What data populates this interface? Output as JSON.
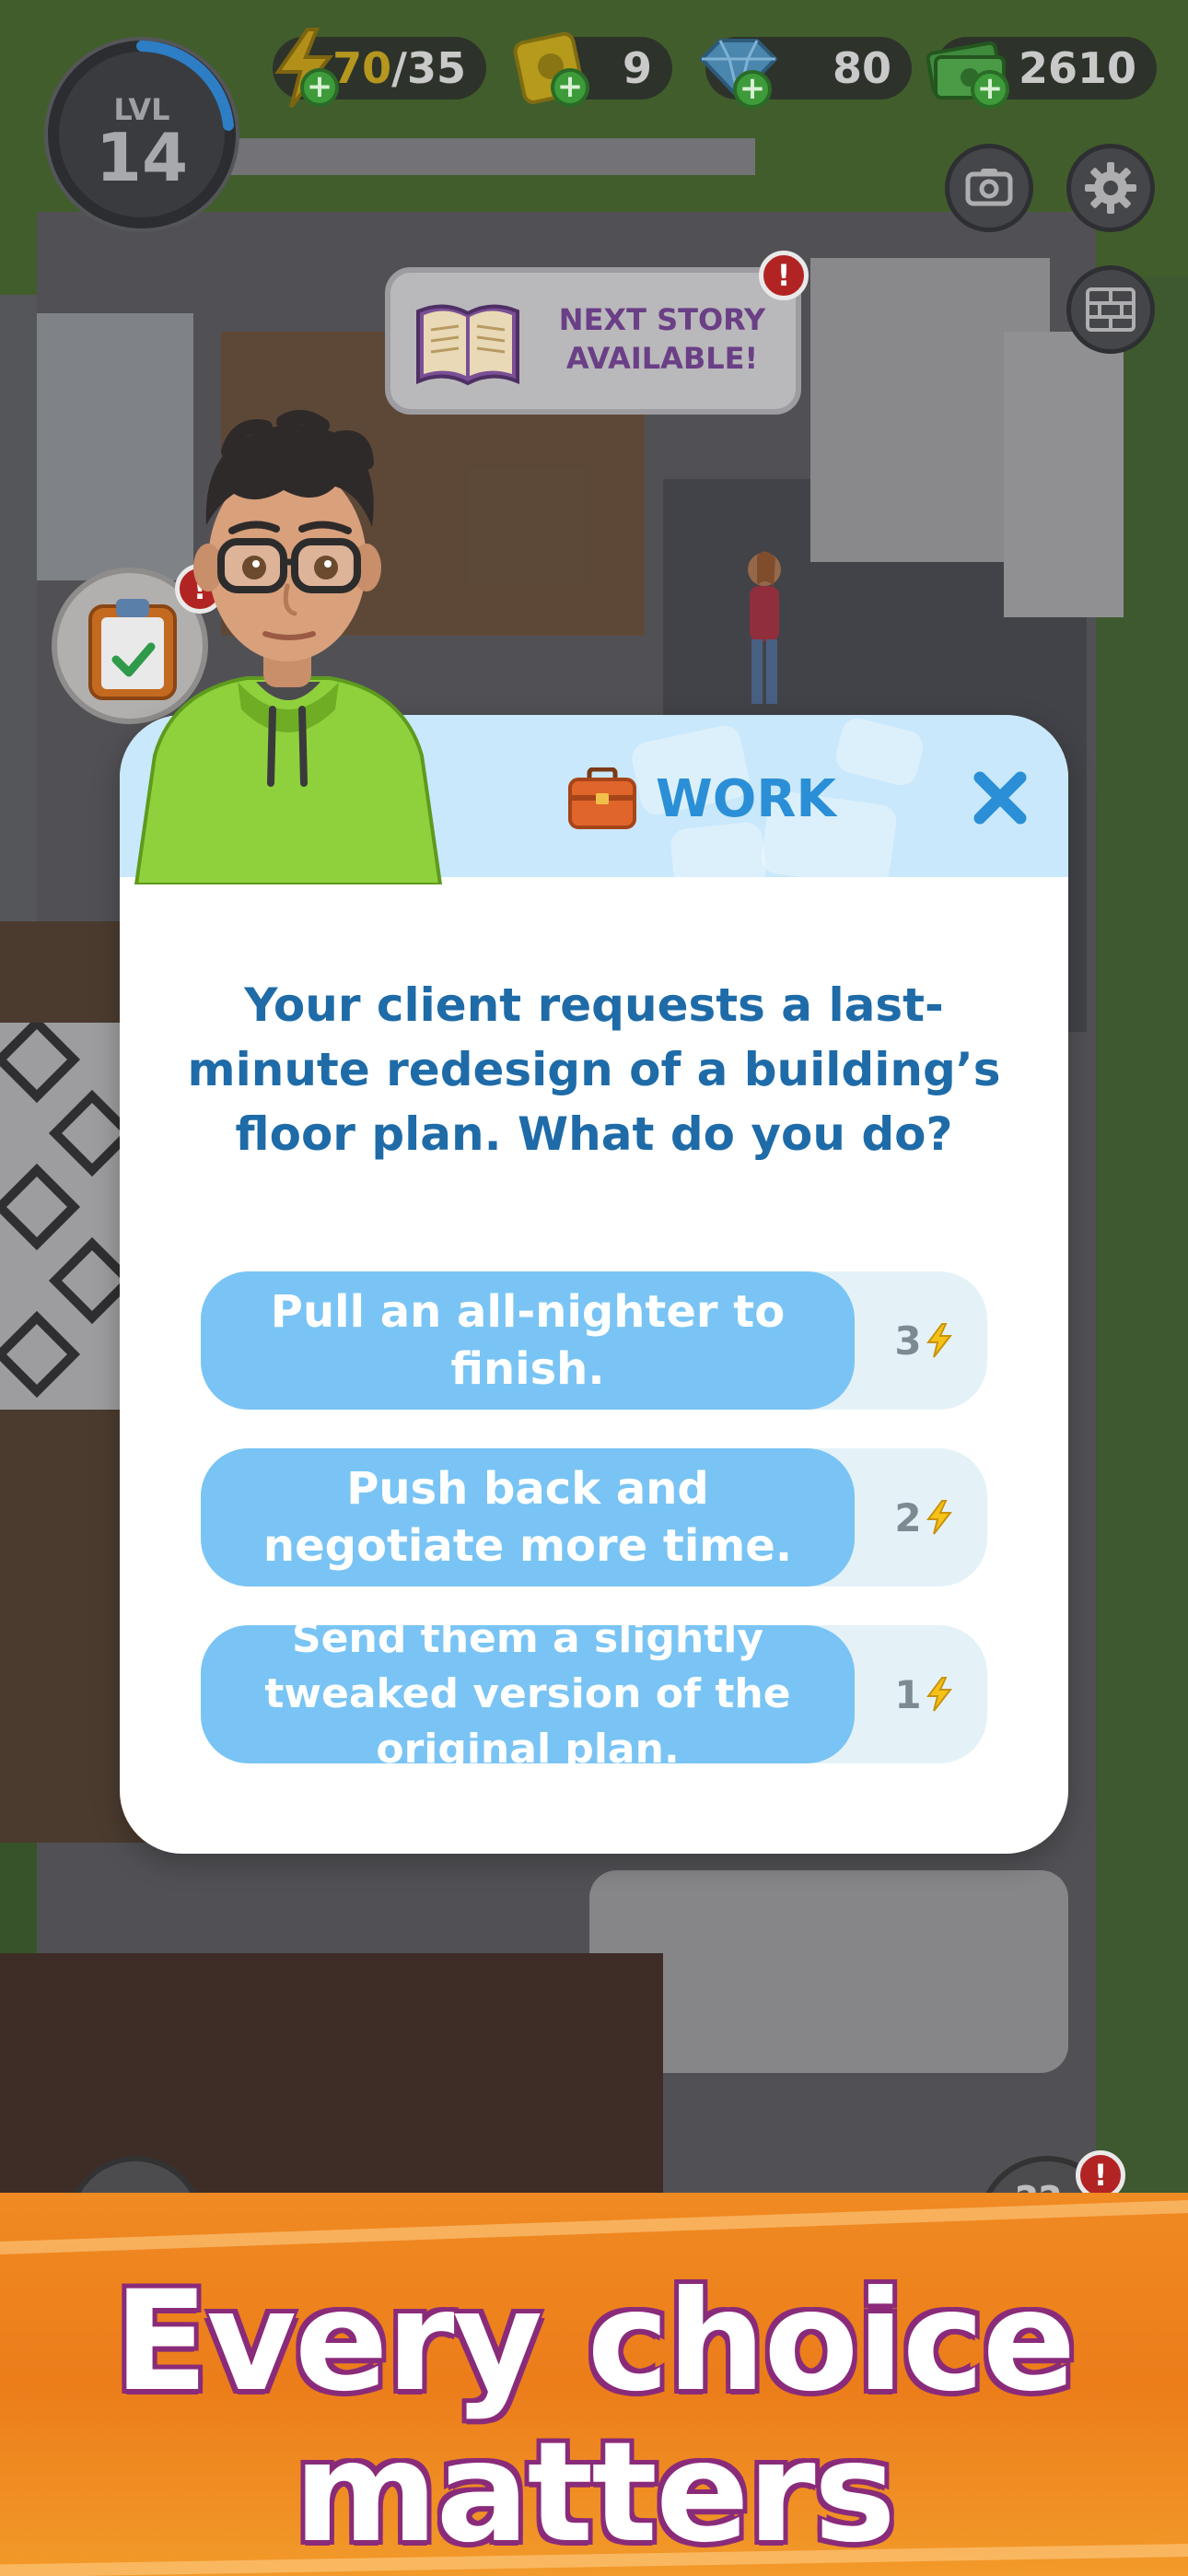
{
  "hud": {
    "level_label": "LVL",
    "level_value": "14",
    "energy_current": "70",
    "energy_max": "/35",
    "tickets": "9",
    "gems": "80",
    "cash": "2610"
  },
  "story_banner": {
    "line1": "NEXT STORY",
    "line2": "AVAILABLE!",
    "alert": "!"
  },
  "task_alert": "!",
  "help_alert": "!",
  "modal": {
    "title": "WORK",
    "question": "Your client requests a last-minute redesign of a building’s floor plan. What do you do?",
    "choices": [
      {
        "label": "Pull an all-nighter to finish.",
        "cost": "3"
      },
      {
        "label": "Push back and negotiate more time.",
        "cost": "2"
      },
      {
        "label": "Send them a slightly tweaked version of the original plan.",
        "cost": "1"
      }
    ]
  },
  "promo": {
    "line1": "Every choice",
    "line2": "matters"
  },
  "colors": {
    "accent_blue": "#2a8fd6",
    "choice_blue": "#79c4f4",
    "promo_orange": "#ee8320",
    "energy_yellow": "#f5c218",
    "alert_red": "#b22424"
  }
}
